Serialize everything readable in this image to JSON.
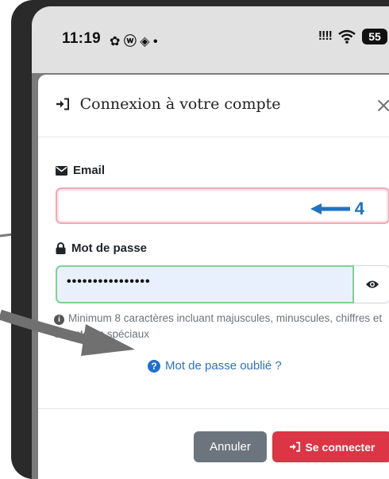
{
  "status_bar": {
    "time": "11:19",
    "notification_icons": "✿ ⓦ ◈ •",
    "signal": "!!!!",
    "battery": "55"
  },
  "modal": {
    "title": "Connexion à votre compte",
    "title_icon": "sign-in-icon",
    "close_label": "×"
  },
  "form": {
    "email_label": "Email",
    "email_value": "",
    "annotation_number": "4",
    "password_label": "Mot de passe",
    "password_value": "••••••••••••••••",
    "password_hint": "Minimum 8 caractères incluant majuscules, minuscules, chiffres et caractères spéciaux",
    "forgot_label": "Mot de passe oublié ?"
  },
  "buttons": {
    "cancel": "Annuler",
    "login": "Se connecter"
  },
  "colors": {
    "primary_red": "#dc3545",
    "secondary_grey": "#6c757d",
    "link_blue": "#2f6fc6",
    "annotation_blue": "#1e73c3",
    "valid_green": "#7ad48f",
    "invalid_pink": "#f4a9b8"
  }
}
